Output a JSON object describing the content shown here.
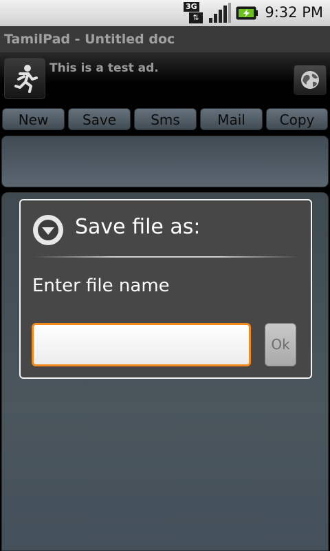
{
  "status_bar": {
    "network_label": "3G",
    "time": "9:32 PM",
    "icons": [
      "3g-data-icon",
      "signal-strength-icon",
      "battery-charging-icon"
    ]
  },
  "app": {
    "title": "TamilPad - Untitled doc"
  },
  "ad": {
    "text": "This is a test ad.",
    "icons": [
      "running-person-icon",
      "globe-icon"
    ]
  },
  "toolbar": {
    "buttons": [
      {
        "label": "New"
      },
      {
        "label": "Save"
      },
      {
        "label": "Sms"
      },
      {
        "label": "Mail"
      },
      {
        "label": "Copy"
      }
    ]
  },
  "dialog": {
    "title": "Save file as:",
    "message": "Enter file name",
    "input_value": "",
    "ok_label": "Ok",
    "icon": "dropdown-arrow-circle-icon"
  },
  "colors": {
    "input_focus_border": "#f28a1c",
    "dialog_background": "#474747",
    "toolbar_button": "#5a666f"
  }
}
